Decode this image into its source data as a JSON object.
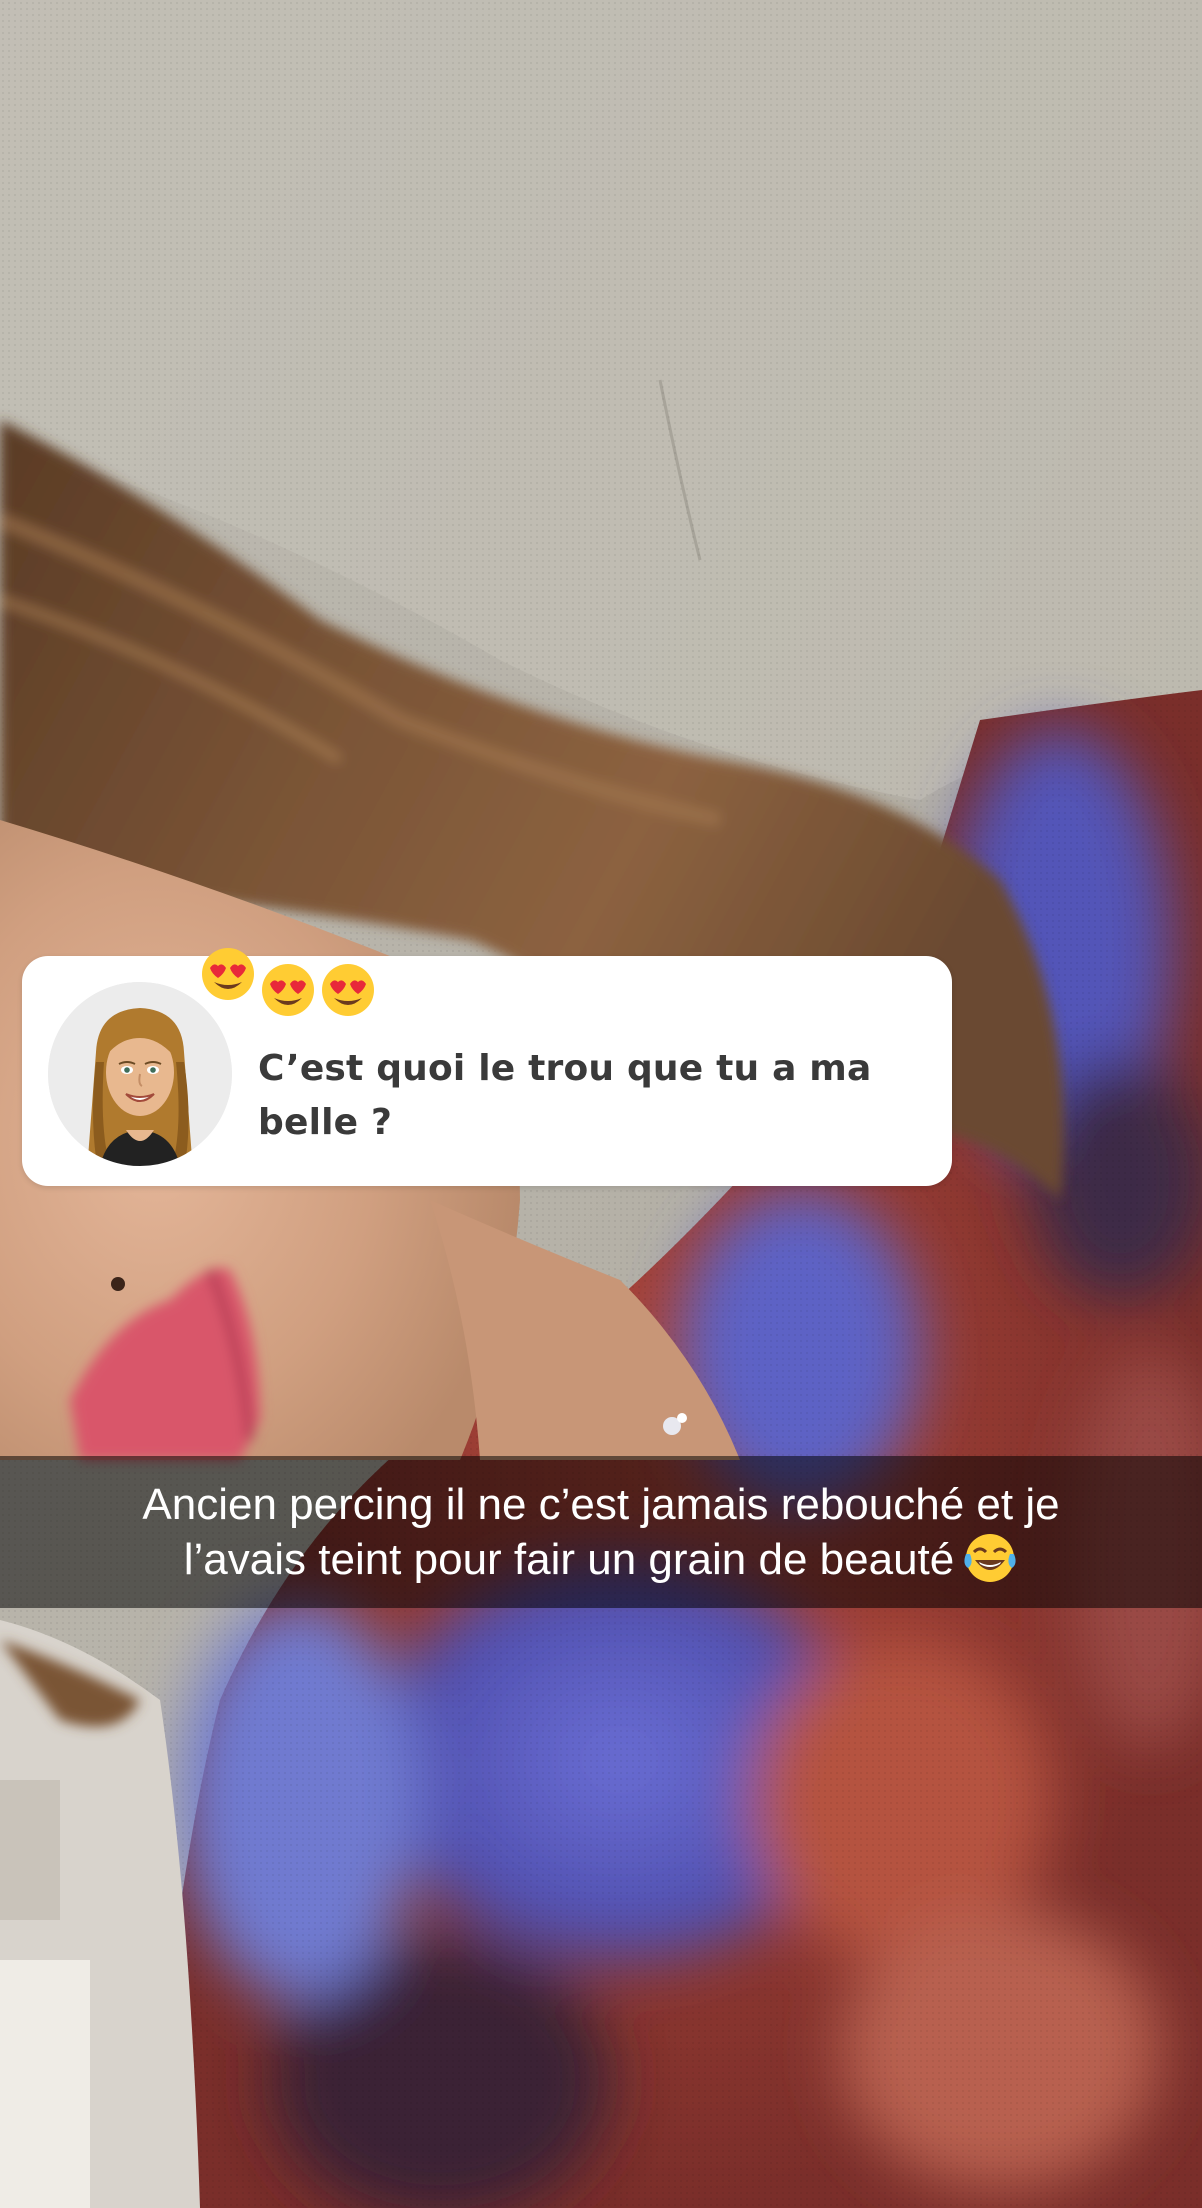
{
  "reply_sticker": {
    "emoji_icon": "heart-eyes-emoji-icon",
    "emoji_count": 3,
    "question_line1": "C’est quoi le trou que tu a ma",
    "question_line2": "belle ?",
    "avatar_icon": "bitmoji-avatar-icon"
  },
  "caption": {
    "line1": "Ancien percing il ne c’est jamais rebouché et je",
    "line2": "l’avais teint pour fair un grain de beauté",
    "emoji_icon": "tears-of-joy-emoji-icon"
  },
  "colors": {
    "card_background": "#ffffff",
    "question_text": "#3a3a3a",
    "caption_text": "#ffffff",
    "caption_bar": "rgba(0,0,0,0.52)"
  }
}
